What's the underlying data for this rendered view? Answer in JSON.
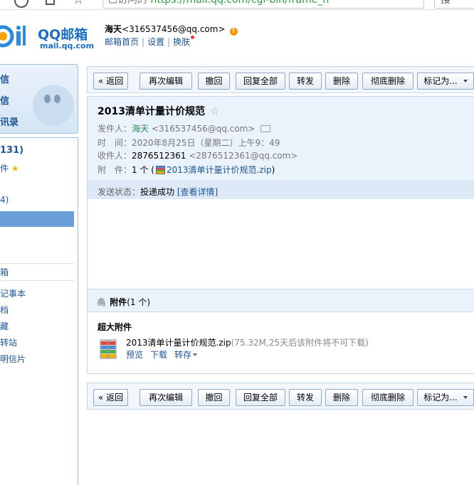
{
  "browser": {
    "address_prefix": "已访问的",
    "address_url": "https://mail.qq.com/cgi-bin/frame_h",
    "search_text": "搜"
  },
  "header": {
    "logo_title": "QQ邮箱",
    "logo_sub": "mail.qq.com",
    "user_name": "海天",
    "user_email": "<316537456@qq.com>",
    "warn_icon": "!",
    "links": [
      "邮箱首页",
      "设置",
      "换肤"
    ],
    "separator": "|"
  },
  "sidebar": {
    "top_items": [
      "信",
      "信",
      "讯录"
    ],
    "folders": [
      {
        "label": "131)",
        "bold": true
      },
      {
        "label": "件",
        "star": "★"
      },
      {
        "label": "4)"
      },
      {
        "label": ""
      }
    ],
    "more": [
      "箱",
      "记事本",
      "档",
      "藏",
      "转站",
      "明信片"
    ]
  },
  "toolbar": {
    "back": "« 返回",
    "re_edit": "再次编辑",
    "recall": "撤回",
    "reply_all": "回复全部",
    "forward": "转发",
    "delete": "删除",
    "delete_perm": "彻底删除",
    "mark_as": "标记为..."
  },
  "mail": {
    "subject": "2013清单计量计价规范",
    "star": "☆",
    "from_label": "发件人：",
    "from_name": "海天",
    "from_email": "<316537456@qq.com>",
    "time_label": "时　间：",
    "time_value": "2020年8月25日（星期二）上午9：49",
    "to_label": "收件人：",
    "to_name": "2876512361",
    "to_email": "<2876512361@qq.com>",
    "attach_label": "附　件：",
    "attach_count": "1 个 (",
    "attach_file": "2013清单计量计价规范.zip",
    "attach_close": ")",
    "status_label": "发送状态：",
    "status_value": "投递成功",
    "status_link": "[查看详情]"
  },
  "attachments": {
    "title": "附件",
    "count": "(1 个)",
    "section": "超大附件",
    "file_name": "2013清单计量计价规范.zip",
    "file_note": "(75.32M,25天后该附件将不可下载)",
    "preview": "预览",
    "download": "下载",
    "save": "转存"
  }
}
